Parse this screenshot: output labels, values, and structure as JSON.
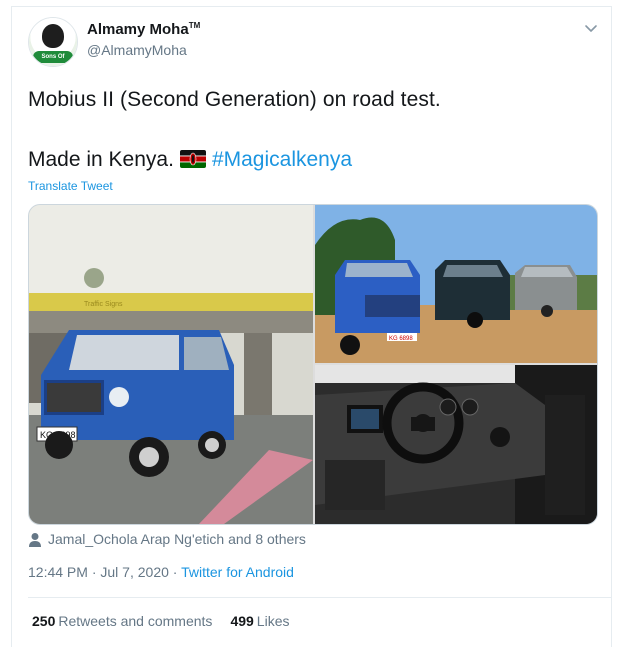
{
  "user": {
    "name": "Almamy Moha",
    "tm": "TM",
    "handle": "@AlmamyMoha",
    "avatar_badge": "Sons Of Kenya"
  },
  "tweet": {
    "line1": "Mobius II (Second Generation) on road test.",
    "line2_text": "Made in Kenya.",
    "flag_icon": "kenya-flag-icon",
    "hashtag": "#Magicalkenya",
    "translate_label": "Translate Tweet"
  },
  "media": {
    "plate_left": "KG 6898",
    "plate_right": "KG 6898",
    "sign_text": "Traffic Signs"
  },
  "liked_by": "Jamal_Ochola Arap Ng'etich and 8 others",
  "timestamp": {
    "time": "12:44 PM",
    "sep1": " · ",
    "date": "Jul 7, 2020",
    "sep2": " · ",
    "source": "Twitter for Android"
  },
  "stats": {
    "retweets_count": "250",
    "retweets_label": "Retweets and comments",
    "likes_count": "499",
    "likes_label": "Likes"
  },
  "colors": {
    "link": "#1b95e0",
    "secondary": "#657786",
    "primary": "#14171a"
  }
}
